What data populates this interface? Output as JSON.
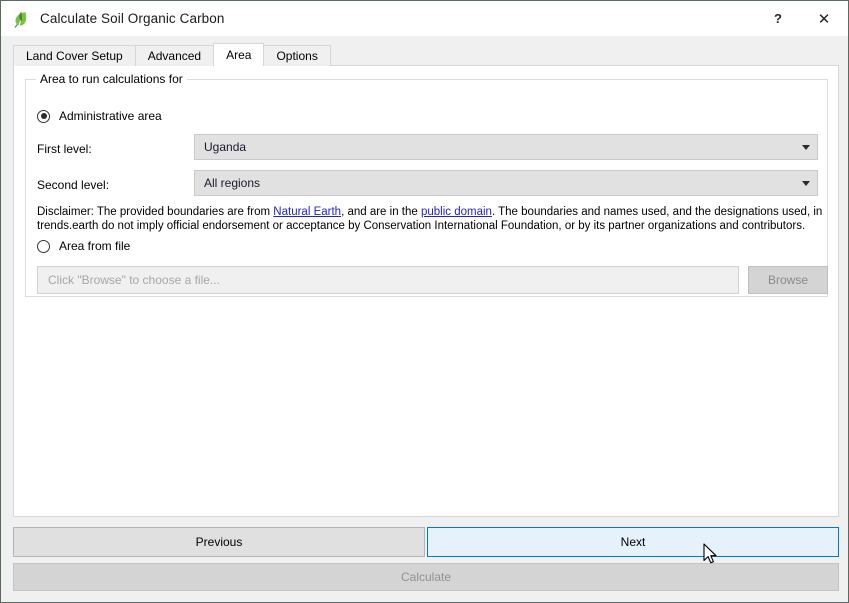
{
  "window": {
    "title": "Calculate Soil Organic Carbon",
    "icon": "leaf-icon",
    "help_label": "?",
    "close_label": "✕"
  },
  "tabs": [
    {
      "label": "Land Cover Setup",
      "active": false
    },
    {
      "label": "Advanced",
      "active": false
    },
    {
      "label": "Area",
      "active": true
    },
    {
      "label": "Options",
      "active": false
    }
  ],
  "area_group": {
    "title": "Area to run calculations for",
    "administrative": {
      "radio_label": "Administrative area",
      "checked": true,
      "first_level": {
        "label": "First level:",
        "value": "Uganda"
      },
      "second_level": {
        "label": "Second level:",
        "value": "All regions"
      }
    },
    "disclaimer": {
      "part1": "Disclaimer: The provided boundaries are from ",
      "link1": "Natural Earth",
      "part2": ", and are in the ",
      "link2": "public domain",
      "part3": ". The boundaries and names used, and the designations used, in trends.earth do not imply official endorsement or acceptance by Conservation International Foundation, or by its partner organizations and contributors."
    },
    "from_file": {
      "radio_label": "Area from file",
      "checked": false,
      "file_placeholder": "Click \"Browse\" to choose a file...",
      "file_value": "",
      "browse_label": "Browse"
    }
  },
  "footer": {
    "previous_label": "Previous",
    "next_label": "Next",
    "calculate_label": "Calculate"
  },
  "colors": {
    "accent": "#0078d7",
    "next_fill": "#e5f1fb",
    "link": "#2222cc",
    "combo_fill": "#e1e1e1",
    "disabled_text": "#919191"
  }
}
